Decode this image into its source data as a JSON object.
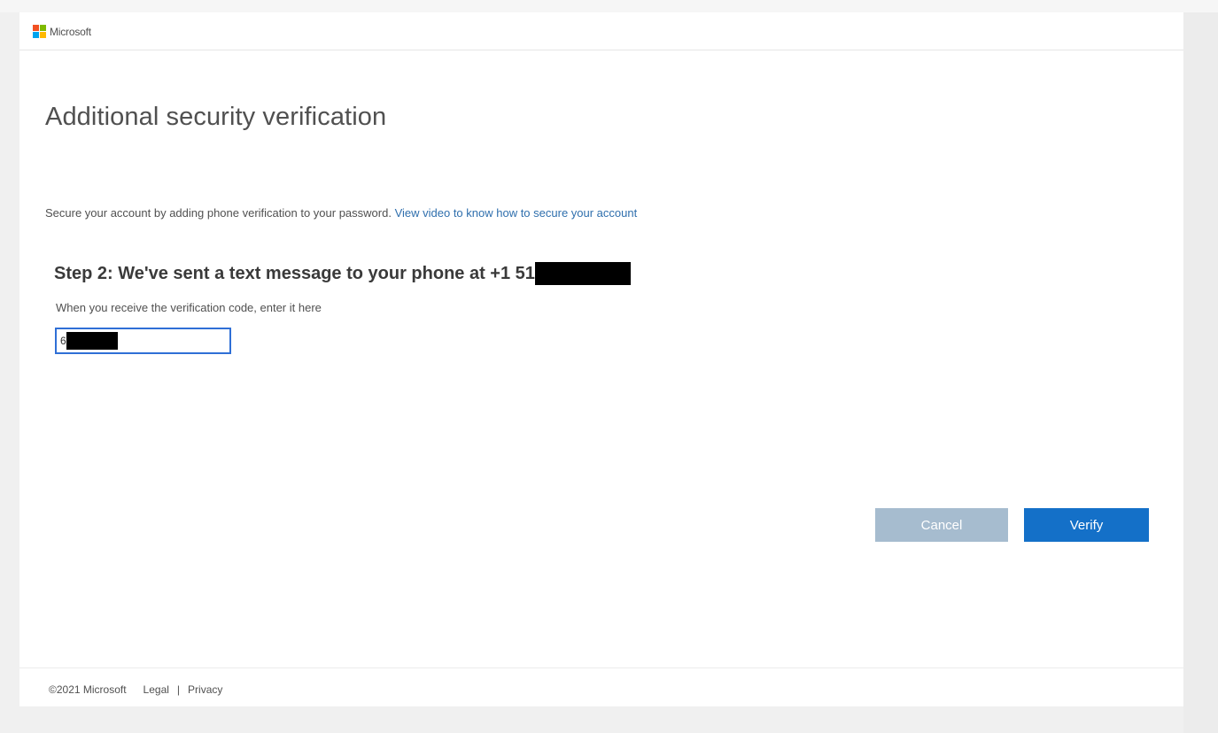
{
  "brand": {
    "name": "Microsoft",
    "logo_colors": [
      "#f25022",
      "#7fba00",
      "#00a4ef",
      "#ffb900"
    ]
  },
  "page": {
    "title": "Additional security verification",
    "intro_text": "Secure your account by adding phone verification to your password.",
    "intro_link": "View video to know how to secure your account"
  },
  "step": {
    "heading": "Step 2: We've sent a text message to your phone at +1 51",
    "instruction": "When you receive the verification code, enter it here",
    "code_value_visible": "6"
  },
  "actions": {
    "cancel_label": "Cancel",
    "verify_label": "Verify"
  },
  "footer": {
    "copyright": "©2021 Microsoft",
    "legal": "Legal",
    "separator": "|",
    "privacy": "Privacy"
  },
  "colors": {
    "accent": "#1470c8",
    "cancel_disabled": "#a6bccf",
    "link": "#2f6fad",
    "input_focus_border": "#2f6fd6"
  }
}
